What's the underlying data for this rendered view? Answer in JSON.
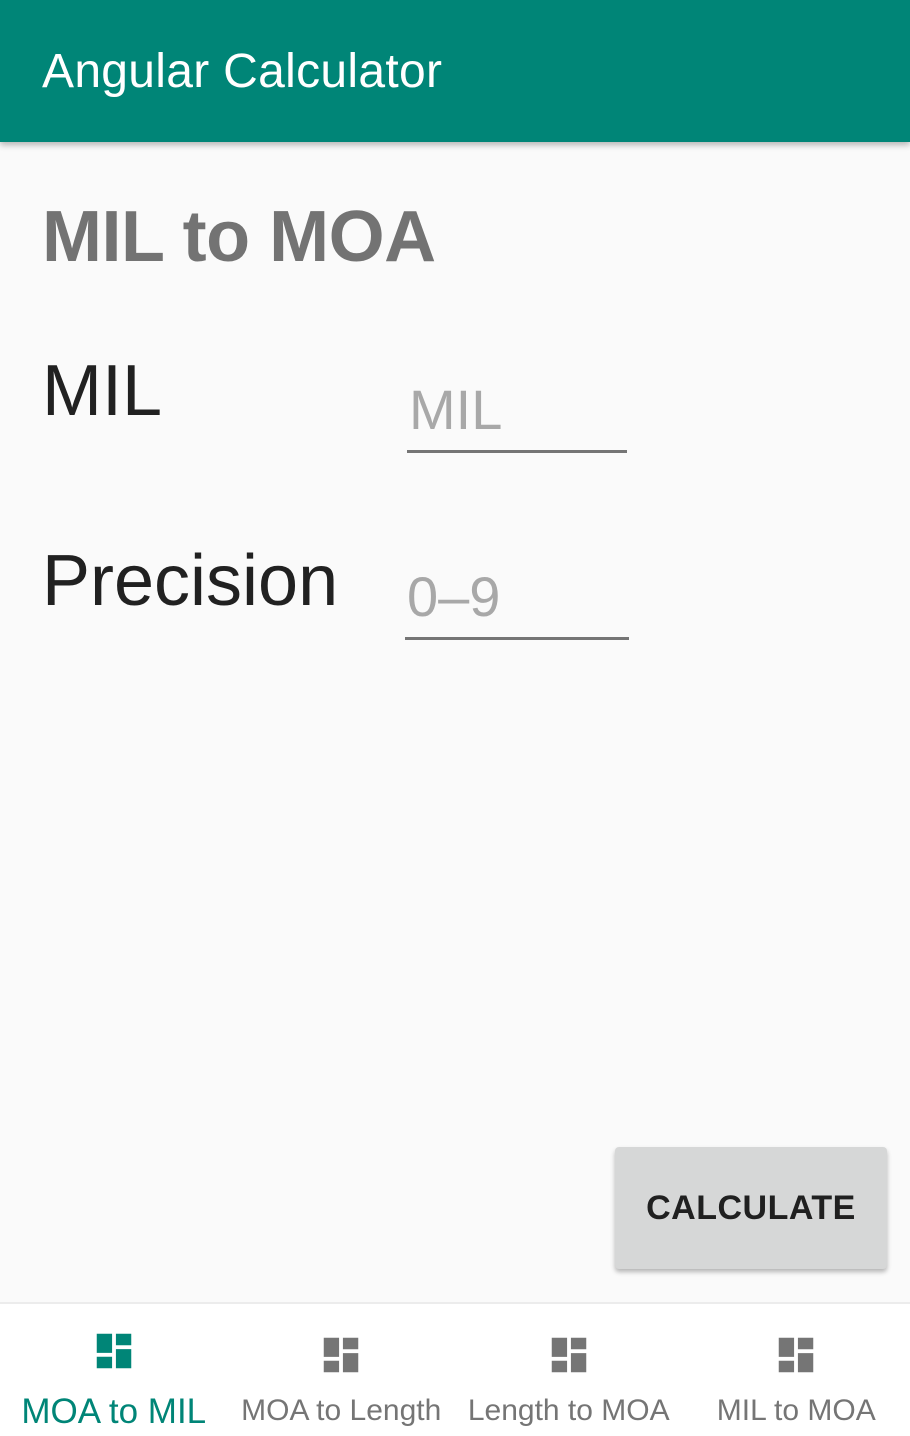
{
  "app_bar": {
    "title": "Angular Calculator"
  },
  "screen": {
    "heading": "MIL to MOA",
    "fields": {
      "mil": {
        "label": "MIL",
        "value": "",
        "placeholder": "MIL"
      },
      "precision": {
        "label": "Precision",
        "value": "",
        "placeholder": "0–9"
      }
    },
    "calculate_label": "CALCULATE"
  },
  "bottom_nav": {
    "items": [
      {
        "label": "MOA to MIL",
        "icon": "dashboard-icon",
        "active": true
      },
      {
        "label": "MOA to Length",
        "icon": "dashboard-icon",
        "active": false
      },
      {
        "label": "Length to MOA",
        "icon": "dashboard-icon",
        "active": false
      },
      {
        "label": "MIL to MOA",
        "icon": "dashboard-icon",
        "active": false
      }
    ]
  },
  "colors": {
    "primary": "#008577",
    "app_bar_text": "#ffffff",
    "heading": "#737373",
    "label": "#212121",
    "placeholder": "#a8a8a8",
    "button_bg": "#d6d7d7",
    "nav_inactive": "#757575",
    "background": "#fafafa"
  }
}
